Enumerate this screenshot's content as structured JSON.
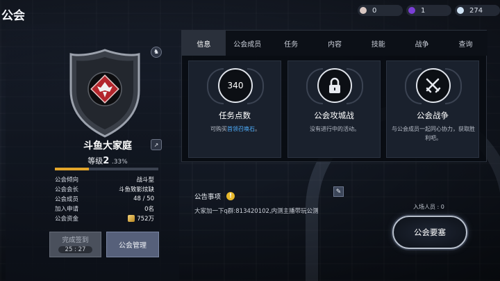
{
  "header": {
    "title": "公会",
    "resources": [
      {
        "icon": "pearl-icon",
        "value": "0",
        "color": "#d9c7c2"
      },
      {
        "icon": "purple-gem-icon",
        "value": "1",
        "color": "#7b3fd6"
      },
      {
        "icon": "diamond-icon",
        "value": "274",
        "color": "#cfe3f5"
      }
    ]
  },
  "guild": {
    "name": "斗鱼大家庭",
    "level_label": "等级",
    "level_value": "2",
    "xp_percent": ".33%",
    "xp_fraction": 0.33,
    "info": [
      {
        "label": "公会倾向",
        "value": "战斗型"
      },
      {
        "label": "公会会长",
        "value": "斗鱼致影炫缺"
      },
      {
        "label": "公会成员",
        "value": "48 / 50"
      },
      {
        "label": "加入申请",
        "value": "0名"
      },
      {
        "label": "公会资金",
        "value": "752万"
      }
    ],
    "sign_label": "完成签到",
    "sign_timer": "25 : 27",
    "manage_label": "公会管理"
  },
  "tabs": [
    "信息",
    "公会成员",
    "任务",
    "内容",
    "技能",
    "战争",
    "查询"
  ],
  "active_tab": 0,
  "cards": [
    {
      "circle_text": "340",
      "title": "任务点数",
      "desc_pre": "可购买",
      "desc_link": "首领召唤石",
      "desc_post": "。"
    },
    {
      "circle_text": "",
      "icon": "lock-icon",
      "title": "公会攻城战",
      "desc_pre": "没有进行中的活动。",
      "desc_link": "",
      "desc_post": ""
    },
    {
      "circle_text": "",
      "icon": "crossed-swords-icon",
      "title": "公会战争",
      "desc_pre": "与公会成员一起同心协力，获取胜利吧。",
      "desc_link": "",
      "desc_post": ""
    }
  ],
  "announcement": {
    "title": "公告事项",
    "warn_glyph": "!",
    "text": "大家加一下q群:813420102,内测主播带玩公测"
  },
  "entered": "入场人员 : 0",
  "fortress_label": "公会要塞"
}
